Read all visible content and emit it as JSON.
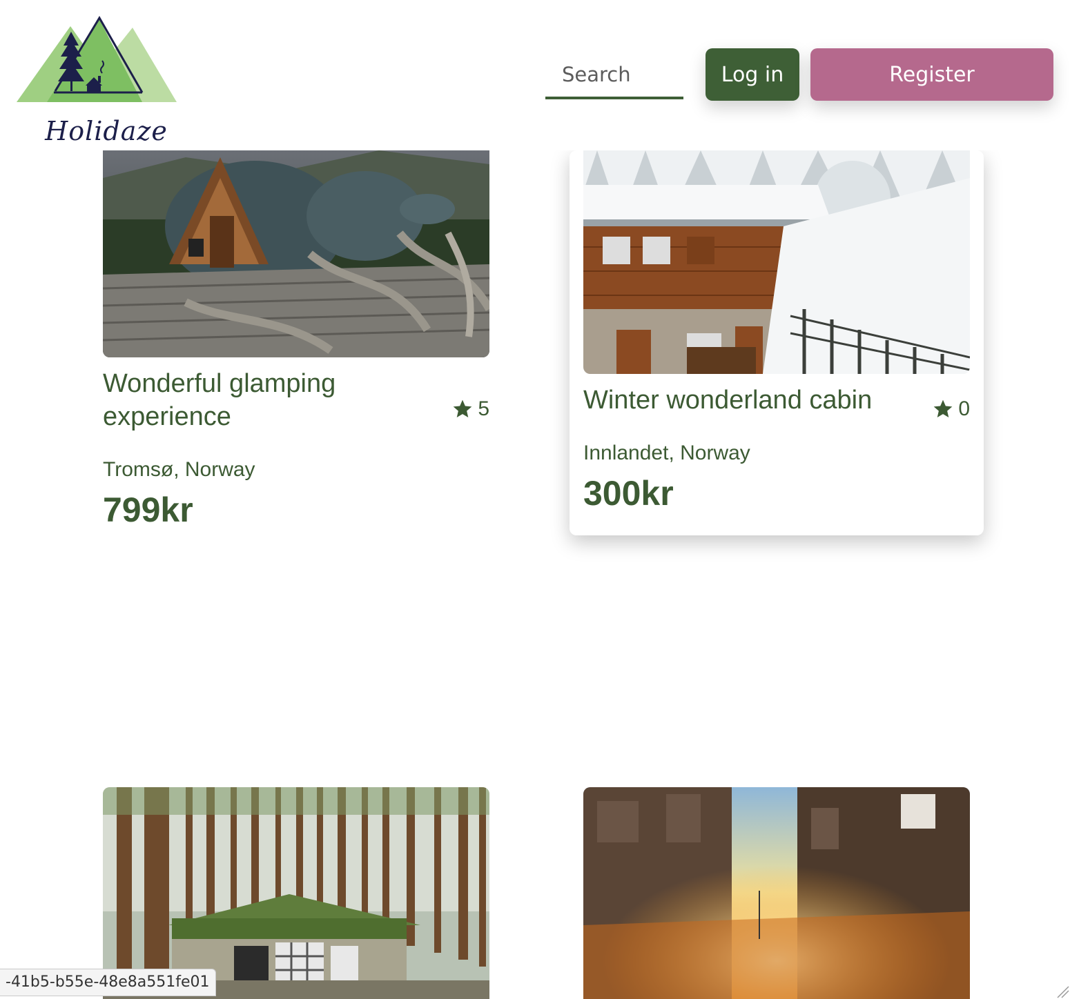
{
  "brand": {
    "name": "Holidaze"
  },
  "header": {
    "search_placeholder": "Search",
    "login_label": "Log in",
    "register_label": "Register"
  },
  "colors": {
    "primary_green": "#3e5f36",
    "register_pink": "#b5698d",
    "logo_navy": "#1c1f4a"
  },
  "cards": [
    {
      "title": "Wonderful glamping experience",
      "rating": "5",
      "location": "Tromsø, Norway",
      "price": "799kr"
    },
    {
      "title": "Winter wonderland cabin",
      "rating": "0",
      "location": "Innlandet, Norway",
      "price": "300kr"
    }
  ],
  "status_bar": {
    "url_fragment": "-41b5-b55e-48e8a551fe01"
  }
}
